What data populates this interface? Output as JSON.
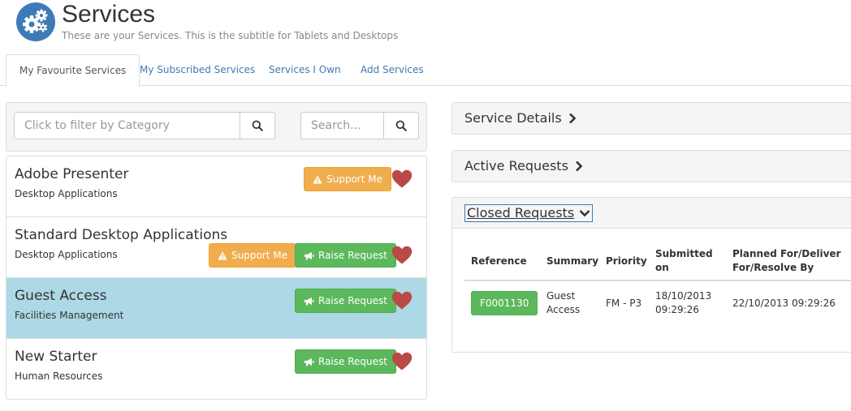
{
  "header": {
    "title": "Services",
    "subtitle": "These are your Services. This is the subtitle for Tablets and Desktops",
    "logo_icon": "gears-icon",
    "accent_color": "#3d7ab8"
  },
  "tabs": [
    {
      "label": "My Favourite Services",
      "active": true
    },
    {
      "label": "My Subscribed Services",
      "active": false
    },
    {
      "label": "Services I Own",
      "active": false
    },
    {
      "label": "Add Services",
      "active": false
    }
  ],
  "filters": {
    "category_placeholder": "Click to filter by Category",
    "search_placeholder": "Search..."
  },
  "services": [
    {
      "name": "Adobe Presenter",
      "category": "Desktop Applications",
      "support_label": "Support Me",
      "raise_label": "",
      "highlighted": false
    },
    {
      "name": "Standard Desktop Applications",
      "category": "Desktop Applications",
      "support_label": "Support Me",
      "raise_label": "Raise Request",
      "highlighted": false
    },
    {
      "name": "Guest Access",
      "category": "Facilities Management",
      "support_label": "",
      "raise_label": "Raise Request",
      "highlighted": true
    },
    {
      "name": "New Starter",
      "category": "Human Resources",
      "support_label": "",
      "raise_label": "Raise Request",
      "highlighted": false
    }
  ],
  "panels": {
    "service_details": "Service Details",
    "active_requests": "Active Requests",
    "closed_requests": "Closed Requests"
  },
  "closed_table": {
    "headers": {
      "reference": "Reference",
      "summary": "Summary",
      "priority": "Priority",
      "submitted_1": "Submitted",
      "submitted_2": "on",
      "planned_1": "Planned For/Deliver",
      "planned_2": "For/Resolve By"
    },
    "rows": [
      {
        "reference": "F0001130",
        "summary_1": "Guest",
        "summary_2": "Access",
        "priority": "FM - P3",
        "submitted_1": "18/10/2013",
        "submitted_2": "09:29:26",
        "planned": "22/10/2013 09:29:26"
      }
    ]
  },
  "colors": {
    "warning": "#f0ad4e",
    "success": "#5cb85c",
    "heart": "#b94a48",
    "highlight_row": "#add8e6"
  }
}
